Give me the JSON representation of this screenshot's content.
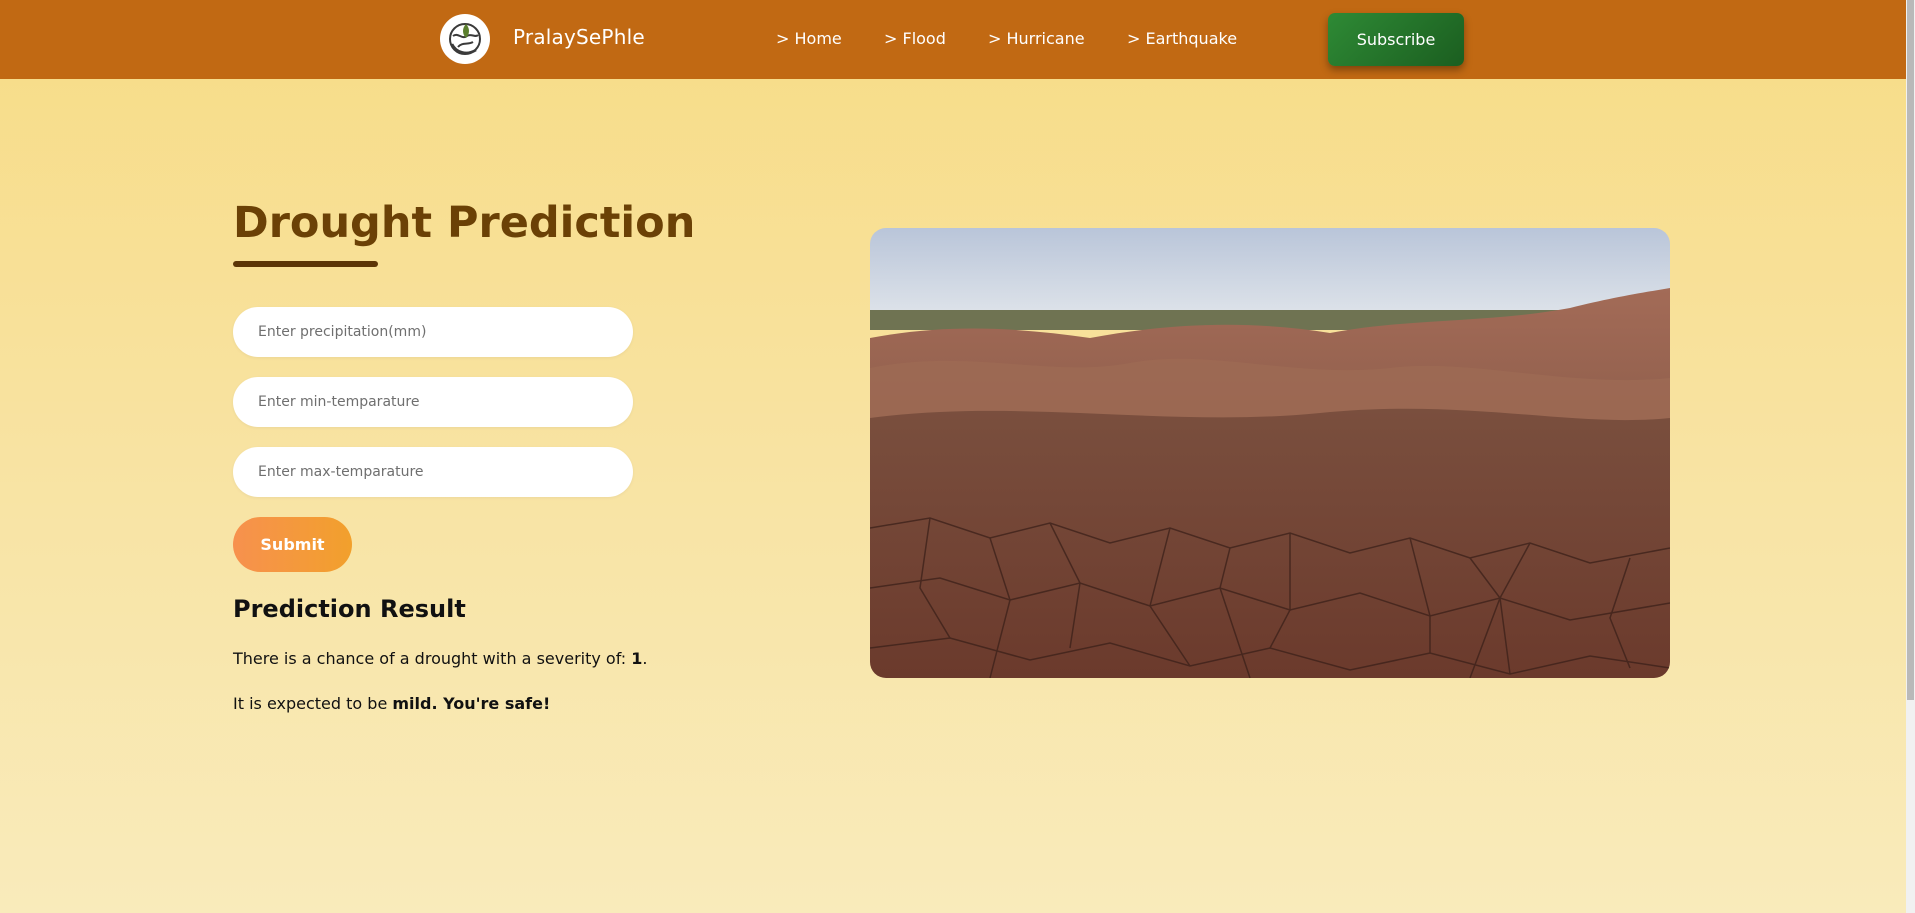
{
  "header": {
    "brand": "PralaySePhle",
    "logo_icon": "globe-leaf-logo",
    "nav": [
      {
        "label": "> Home"
      },
      {
        "label": "> Flood"
      },
      {
        "label": "> Hurricane"
      },
      {
        "label": "> Earthquake"
      }
    ],
    "subscribe_label": "Subscribe"
  },
  "main": {
    "title": "Drought Prediction",
    "form": {
      "precipitation_placeholder": "Enter precipitation(mm)",
      "min_temp_placeholder": "Enter min-temparature",
      "max_temp_placeholder": "Enter max-temparature",
      "submit_label": "Submit"
    },
    "result": {
      "heading": "Prediction Result",
      "line1_prefix": "There is a chance of a drought with a severity of: ",
      "severity": "1",
      "line1_suffix": ".",
      "line2_prefix": "It is expected to be ",
      "line2_emphasis": "mild. You're safe!"
    },
    "image_subject": "cracked dry earth landscape"
  },
  "colors": {
    "header_bg": "#c16913",
    "title": "#6b4106",
    "subscribe_green": "#2e8a35",
    "submit_orange": "#f7914e",
    "page_bg_top": "#f7dc86",
    "page_bg_bottom": "#f9ebbb"
  }
}
